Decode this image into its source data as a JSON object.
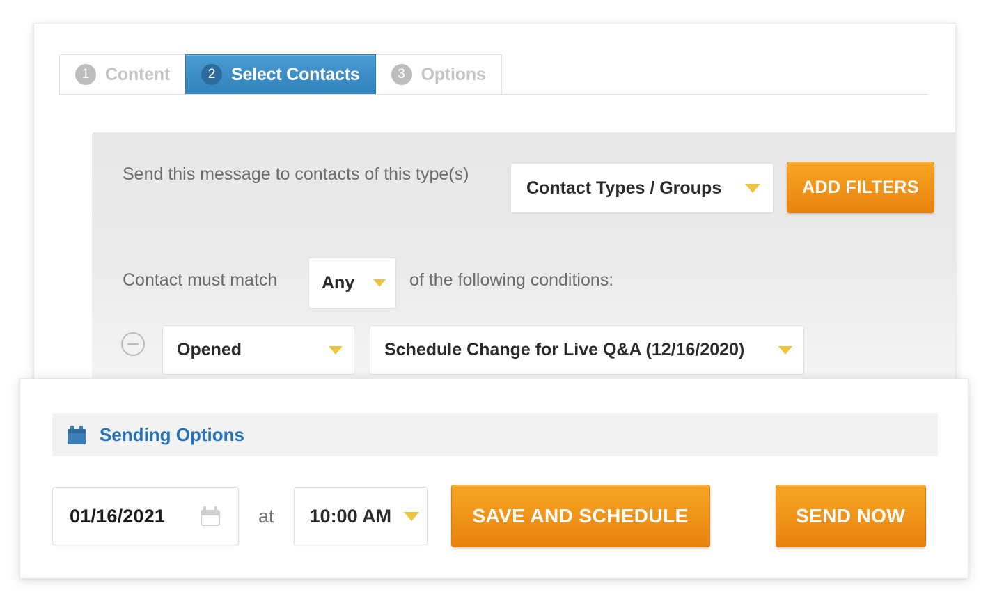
{
  "back_card": {
    "tabs": [
      {
        "number": "1",
        "label": "Content",
        "active": false,
        "name": "tab-content"
      },
      {
        "number": "2",
        "label": "Select Contacts",
        "active": true,
        "name": "tab-select-contacts"
      },
      {
        "number": "3",
        "label": "Options",
        "active": false,
        "name": "tab-options"
      }
    ],
    "filter_panel": {
      "send_to_label": "Send this message to contacts of this type(s)",
      "contact_types_select": "Contact Types / Groups",
      "add_filters_button": "ADD FILTERS",
      "match_prefix_label": "Contact must match",
      "match_mode_select": "Any",
      "match_suffix_label": "of the following conditions:",
      "conditions": [
        {
          "action_select": "Opened",
          "target_select": "Schedule Change for Live Q&A (12/16/2020)",
          "remove_icon": "minus-circle-icon"
        }
      ]
    }
  },
  "front_card": {
    "section_title": "Sending Options",
    "section_icon": "calendar-icon",
    "date_value": "01/16/2021",
    "date_icon": "calendar-icon",
    "at_label": "at",
    "time_value": "10:00 AM",
    "save_and_schedule_button": "SAVE AND SCHEDULE",
    "send_now_button": "SEND NOW"
  },
  "colors": {
    "accent_blue": "#3282bb",
    "badge_blue": "#2b6c9c",
    "heading_blue": "#2573b5",
    "orange": "#ef9016",
    "caret_yellow": "#edc33f",
    "panel_grey": "#eaeaea",
    "muted_text": "#6c6c6c",
    "inactive_tab_text": "#c4c4c4"
  }
}
